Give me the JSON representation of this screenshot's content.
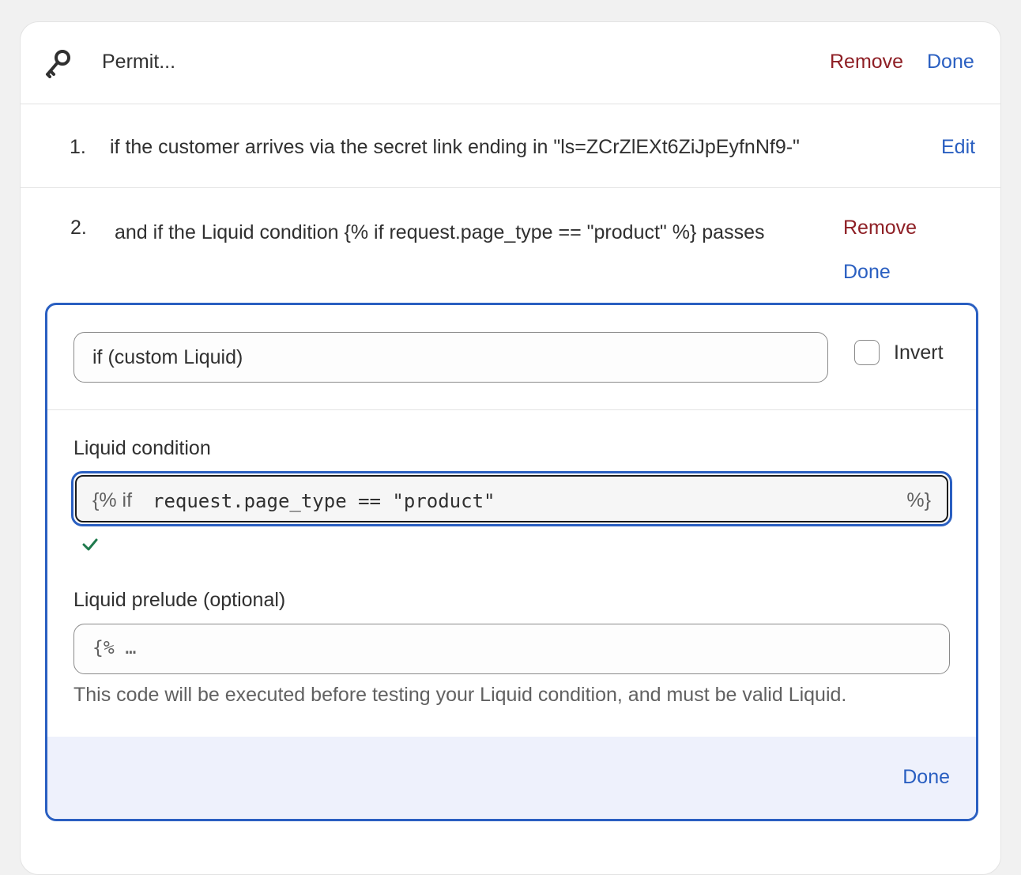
{
  "header": {
    "title": "Permit...",
    "remove_label": "Remove",
    "done_label": "Done"
  },
  "conditions": [
    {
      "number": "1.",
      "text": "if the customer arrives via the secret link ending in \"ls=ZCrZlEXt6ZiJpEyfnNf9-\"",
      "edit_label": "Edit"
    },
    {
      "number": "2.",
      "text": "and if the Liquid condition {% if request.page_type == \"product\" %} passes",
      "remove_label": "Remove",
      "done_label": "Done"
    }
  ],
  "editor": {
    "condition_type": "if (custom Liquid)",
    "invert_label": "Invert",
    "invert_checked": false,
    "liquid_condition_label": "Liquid condition",
    "liquid_prefix": "{% if",
    "liquid_value": "request.page_type == \"product\"",
    "liquid_suffix": "%}",
    "valid": true,
    "prelude_label": "Liquid prelude (optional)",
    "prelude_placeholder": "{% …",
    "prelude_help": "This code will be executed before testing your Liquid condition, and must be valid Liquid.",
    "footer_done_label": "Done"
  },
  "colors": {
    "accent": "#2a5fc1",
    "destructive": "#8e1f25",
    "success": "#1f7a4d",
    "footer_bg": "#eef1fc"
  },
  "icons": {
    "header": "key-icon",
    "valid": "checkmark-icon"
  }
}
